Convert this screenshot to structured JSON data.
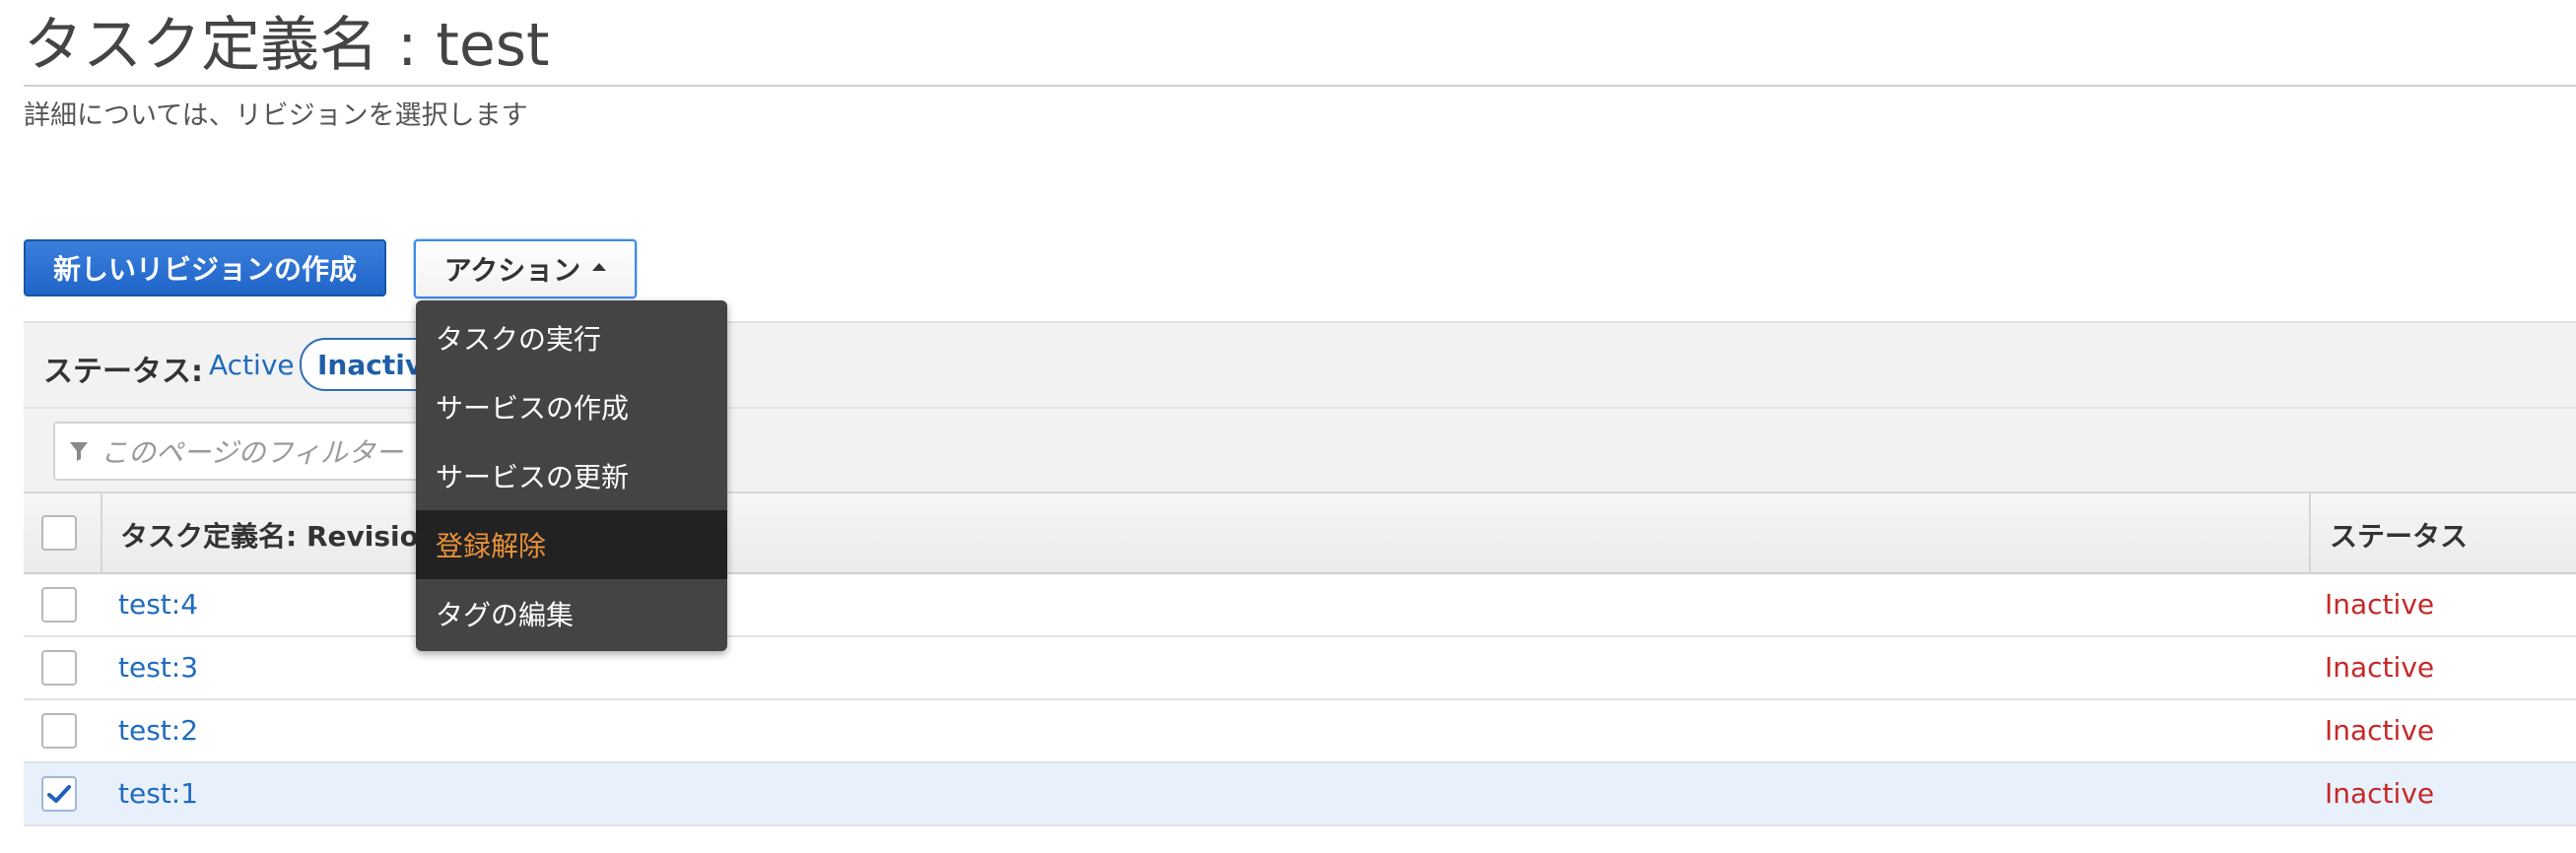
{
  "page": {
    "title": "タスク定義名 : test",
    "subtitle": "詳細については、リビジョンを選択します"
  },
  "toolbar": {
    "create_revision_label": "新しいリビジョンの作成",
    "actions_label": "アクション"
  },
  "actions_menu": {
    "items": [
      {
        "label": "タスクの実行"
      },
      {
        "label": "サービスの作成"
      },
      {
        "label": "サービスの更新"
      },
      {
        "label": "登録解除",
        "highlighted": true
      },
      {
        "label": "タグの編集"
      }
    ],
    "highlight_color": "#e8913a"
  },
  "status_filter": {
    "label": "ステータス:",
    "options": [
      "Active",
      "Inactive"
    ],
    "selected": "Inactive"
  },
  "filter": {
    "placeholder": "このページのフィルター",
    "icon": "filter-icon"
  },
  "table": {
    "columns": [
      "タスク定義名: Revision",
      "ステータス"
    ],
    "rows": [
      {
        "name": "test:4",
        "status": "Inactive",
        "checked": false
      },
      {
        "name": "test:3",
        "status": "Inactive",
        "checked": false
      },
      {
        "name": "test:2",
        "status": "Inactive",
        "checked": false
      },
      {
        "name": "test:1",
        "status": "Inactive",
        "checked": true
      }
    ]
  },
  "colors": {
    "link": "#1f6bbf",
    "inactive_status": "#c62828",
    "primary_button": "#2a6fd0"
  }
}
